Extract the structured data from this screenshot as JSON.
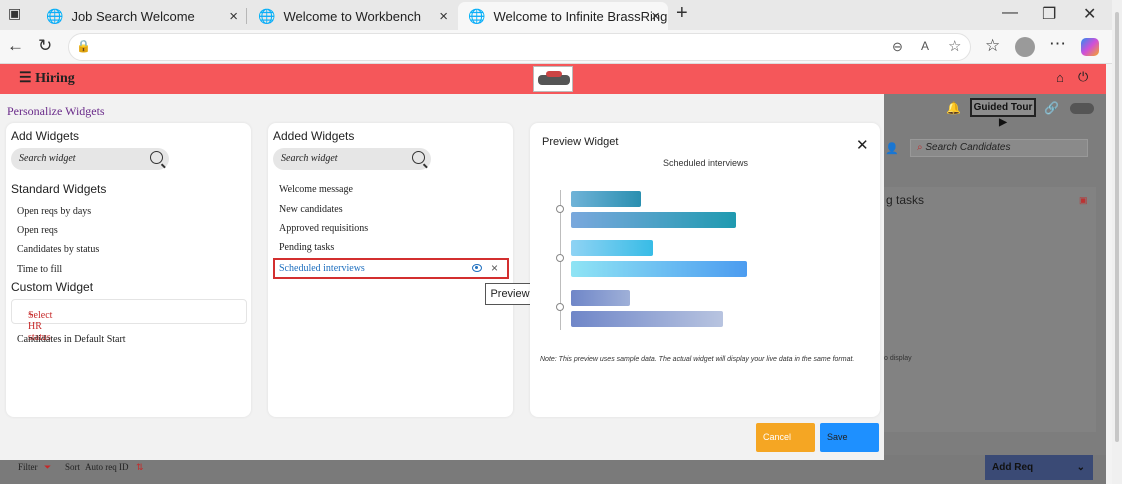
{
  "browser": {
    "tabs": [
      {
        "title": "Job Search Welcome",
        "active": false
      },
      {
        "title": "Welcome to Workbench",
        "active": false
      },
      {
        "title": "Welcome to Infinite BrassRing",
        "active": true
      }
    ],
    "new_tab": "+",
    "close_glyph": "×",
    "window": {
      "minimize": "—",
      "restore": "❐",
      "close": "✕"
    },
    "toolbar_icons": [
      "back-arrow-icon",
      "reload-icon",
      "lock-icon",
      "zoom-icon",
      "read-aloud-icon",
      "favorite-star-icon",
      "favorites-icon",
      "profile-icon",
      "more-icon",
      "copilot-icon"
    ]
  },
  "app": {
    "menu_label": "Hiring",
    "accent_color": "#f5575a"
  },
  "background": {
    "guided_tour": "Guided Tour ▶",
    "search_placeholder": "Search Candidates",
    "card_title": "g tasks",
    "card_empty": "o display",
    "footer": {
      "filter": "Filter",
      "sort": "Sort",
      "sort_value": "Auto req ID",
      "add_req": "Add Req"
    }
  },
  "modal": {
    "title": "Personalize Widgets",
    "add_widgets": {
      "heading": "Add Widgets",
      "search_placeholder": "Search widget",
      "standard_heading": "Standard Widgets",
      "standard_items": [
        "Open reqs by days",
        "Open reqs",
        "Candidates by status",
        "Time to fill"
      ],
      "custom_heading": "Custom Widget",
      "select_hr_status": "Select HR status",
      "custom_items": [
        "Candidates in Default Start"
      ]
    },
    "added_widgets": {
      "heading": "Added Widgets",
      "search_placeholder": "Search widget",
      "items": [
        "Welcome message",
        "New candidates",
        "Approved requisitions",
        "Pending tasks"
      ],
      "selected_item": "Scheduled interviews",
      "tooltip": "Preview"
    },
    "preview": {
      "heading": "Preview Widget",
      "subtitle": "Scheduled interviews",
      "note": "Note: This preview uses sample data. The actual widget will display your live data in the same format."
    },
    "buttons": {
      "cancel": "Cancel",
      "save": "Save"
    }
  }
}
